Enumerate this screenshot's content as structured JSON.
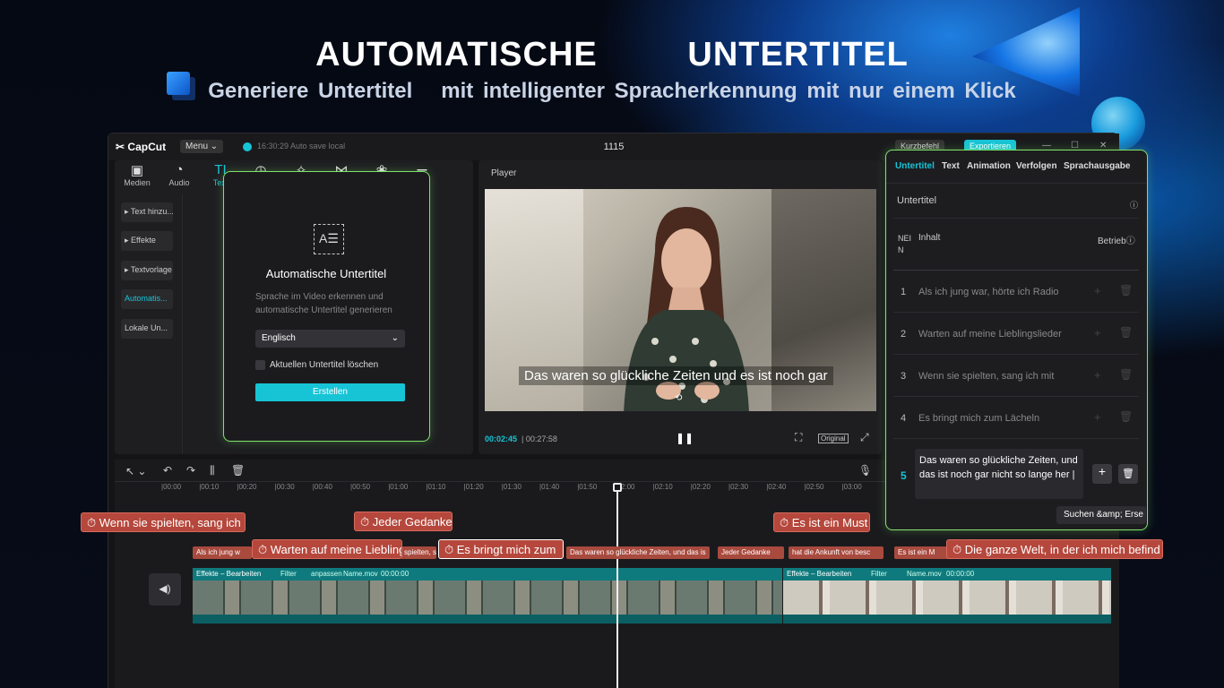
{
  "hero": {
    "title": "AUTOMATISCHE   UNTERTITEL",
    "subtitle": "Generiere Untertitel   mit intelligenter Spracherkennung mit nur einem Klick"
  },
  "app": {
    "logo": "CapCut",
    "menu": "Menu",
    "autosave": "16:30:29 Auto save local",
    "project": "1115",
    "shortcuts": "Kurzbefehl",
    "export": "Exportieren"
  },
  "toolbar": [
    "Medien",
    "Audio",
    "Text",
    "Sticker",
    "Effekte",
    "Übergänge",
    "Filter",
    "Anpassung"
  ],
  "sidebar": [
    "Text hinzu...",
    "Effekte",
    "Textvorlage",
    "Automatis...",
    "Lokale Un..."
  ],
  "autopanel": {
    "title": "Automatische Untertitel",
    "desc": "Sprache im Video erkennen und automatische Untertitel generieren",
    "language": "Englisch",
    "checkbox": "Aktuellen Untertitel löschen",
    "create": "Erstellen"
  },
  "player": {
    "label": "Player",
    "subtitle": "Das waren so glückliche Zeiten und es ist noch gar",
    "current": "00:02:45",
    "total": "00:27:58",
    "original": "Original"
  },
  "timeline": {
    "ticks": [
      "|00:00",
      "|00:10",
      "|00:20",
      "|00:30",
      "|00:40",
      "|00:50",
      "|01:00",
      "|01:10",
      "|01:20",
      "|01:30",
      "|01:40",
      "|01:50",
      "|02:00",
      "|02:10",
      "|02:20",
      "|02:30",
      "|02:40",
      "|02:50",
      "|03:00"
    ],
    "chips_top": [
      "Wenn sie spielten, sang ich",
      "Jeder Gedanke",
      "Es ist ein Must"
    ],
    "chips_mid": [
      "Warten auf meine Lieblingsl",
      "Es bringt mich zum",
      "Die ganze Welt, in der ich mich befind"
    ],
    "small": [
      "Als ich jung w",
      "spielten, sa",
      "Das waren so glückliche Zeiten, und das is",
      "Jeder Gedanke",
      "hat die Ankunft von besc",
      "Es ist ein M"
    ],
    "track1": [
      "Effekte – Bearbeiten",
      "Filter",
      "anpassen",
      "Name.mov",
      "00:00:00"
    ],
    "track2": [
      "Effekte – Bearbeiten",
      "Filter",
      "Name.mov",
      "00:00:00"
    ]
  },
  "rightpanel": {
    "tabs": [
      "Untertitel",
      "Text",
      "Animation",
      "Verfolgen",
      "Sprachausgabe"
    ],
    "section": "Untertitel",
    "col_num": "NEIN",
    "col_content": "Inhalt",
    "col_op": "Betrieb",
    "rows": [
      {
        "n": "1",
        "t": "Als ich jung war, hörte ich Radio"
      },
      {
        "n": "2",
        "t": "Warten auf meine Lieblingslieder"
      },
      {
        "n": "3",
        "t": "Wenn sie spielten, sang ich mit"
      },
      {
        "n": "4",
        "t": "Es bringt mich zum Lächeln"
      }
    ],
    "edit_n": "5",
    "edit_text": "Das waren so glückliche Zeiten, und das ist noch gar nicht so lange her |",
    "search": "Suchen &amp; Erse"
  },
  "colors": {
    "accent": "#17c4d6",
    "glow": "#7fe36a",
    "chip": "#b5473c"
  }
}
